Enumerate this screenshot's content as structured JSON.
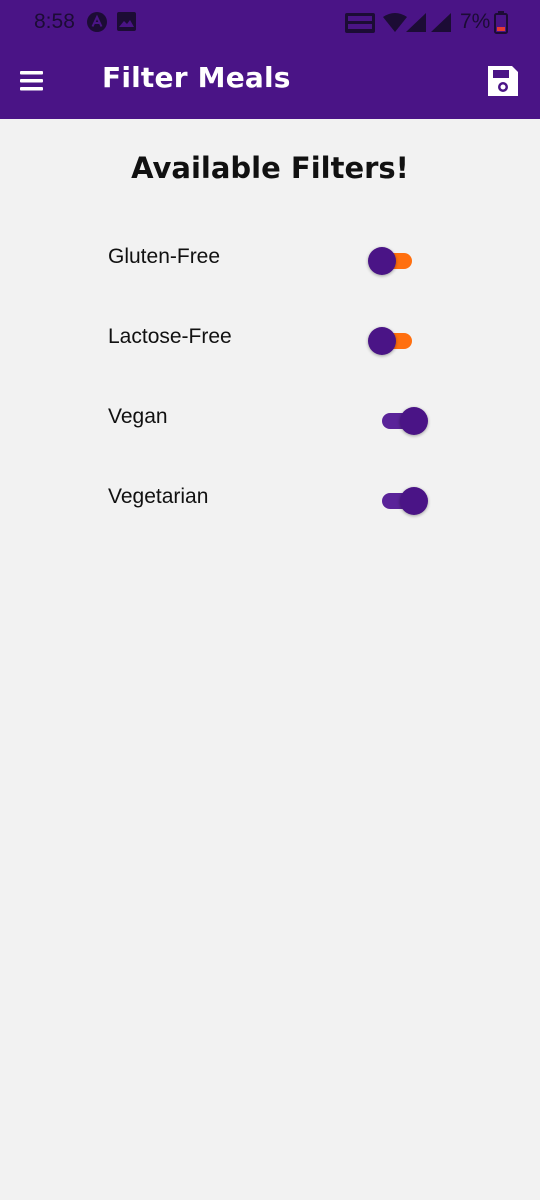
{
  "status_bar": {
    "time": "8:58",
    "battery_percent": "7%",
    "icons": [
      "a-circle-icon",
      "image-icon",
      "volte-wifi-icon",
      "wifi-icon",
      "signal-icon",
      "signal-r-icon",
      "battery-low-icon"
    ]
  },
  "app_bar": {
    "title": "Filter Meals",
    "menu_icon": "menu-icon",
    "save_icon": "save-icon"
  },
  "main": {
    "heading": "Available Filters!",
    "filters": [
      {
        "label": "Gluten-Free",
        "enabled": false
      },
      {
        "label": "Lactose-Free",
        "enabled": false
      },
      {
        "label": "Vegan",
        "enabled": true
      },
      {
        "label": "Vegetarian",
        "enabled": true
      }
    ]
  },
  "colors": {
    "primary": "#4a1486",
    "accent": "#ff6f0f",
    "background": "#f2f2f2",
    "app_bar_text": "#ffffff"
  }
}
